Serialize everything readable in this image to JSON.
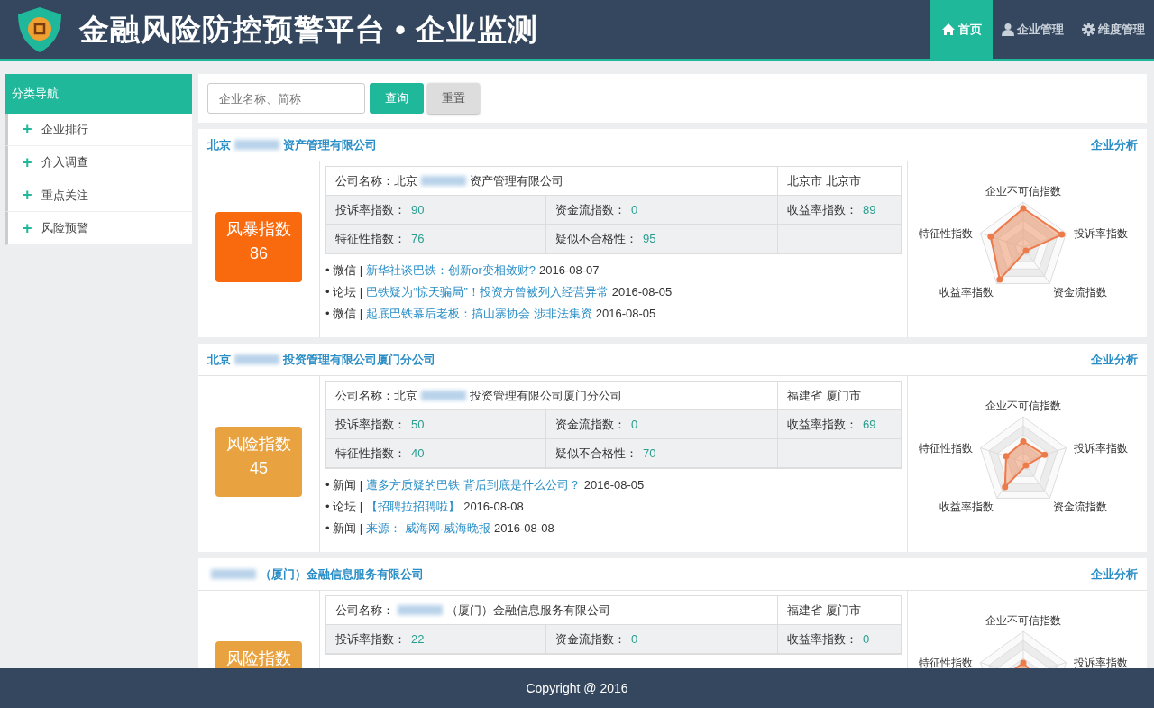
{
  "header": {
    "title": "金融风险防控预警平台 • 企业监测",
    "nav": [
      {
        "label": "首页",
        "selected": true
      },
      {
        "label": "企业管理",
        "selected": false
      },
      {
        "label": "维度管理",
        "selected": false
      }
    ]
  },
  "sidebar": {
    "title": "分类导航",
    "items": [
      {
        "label": "企业排行",
        "icon": "+"
      },
      {
        "label": "介入调查",
        "icon": "+"
      },
      {
        "label": "重点关注",
        "icon": "+"
      },
      {
        "label": "风险预警",
        "icon": "+"
      }
    ]
  },
  "search": {
    "placeholder": "企业名称、简称",
    "buttons": [
      {
        "label": "查询",
        "kind": "primary"
      },
      {
        "label": "重置",
        "kind": "secondary"
      }
    ]
  },
  "companies": [
    {
      "heading": {
        "before": "北京",
        "after": "资产管理有限公司",
        "blurred": true
      },
      "link": "企业分析",
      "badge": {
        "label": "风暴指数",
        "score": "86",
        "color": "#f96a0f"
      },
      "info_label": "公司名称：",
      "info_name": {
        "before": "北京",
        "after": "资产管理有限公司",
        "blurred": true
      },
      "location": "北京市 北京市",
      "metrics": [
        {
          "label": "投诉率指数：",
          "value": "90"
        },
        {
          "label": "资金流指数：",
          "value": "0"
        },
        {
          "label": "收益率指数：",
          "value": "89"
        },
        {
          "label": "特征性指数：",
          "value": "76"
        },
        {
          "label": "疑似不合格性：",
          "value": "95"
        }
      ],
      "news": [
        {
          "source": "• 微信 |",
          "title": "新华社谈巴铁：创新or变相敛财?",
          "date": "2016-08-07"
        },
        {
          "source": "• 论坛 |",
          "title": "巴铁疑为“惊天骗局”！投资方曾被列入经营异常",
          "date": "2016-08-05"
        },
        {
          "source": "• 微信 |",
          "title": "起底巴铁幕后老板：搞山寨协会 涉非法集资",
          "date": "2016-08-05"
        }
      ],
      "radar": [
        {
          "label": "企业不可信指数",
          "kind": "top"
        },
        {
          "label": "投诉率指数",
          "kind": "right"
        },
        {
          "label": "资金流指数",
          "kind": "bottom-right"
        },
        {
          "label": "收益率指数",
          "kind": "bottom-left"
        },
        {
          "label": "特征性指数",
          "kind": "left"
        }
      ]
    },
    {
      "heading": {
        "before": "北京",
        "after": "投资管理有限公司厦门分公司",
        "blurred": true
      },
      "link": "企业分析",
      "badge": {
        "label": "风险指数",
        "score": "45",
        "color": "#e8a23f"
      },
      "info_label": "公司名称：",
      "info_name": {
        "before": "北京",
        "after": "投资管理有限公司厦门分公司",
        "blurred": true
      },
      "location": "福建省 厦门市",
      "metrics": [
        {
          "label": "投诉率指数：",
          "value": "50"
        },
        {
          "label": "资金流指数：",
          "value": "0"
        },
        {
          "label": "收益率指数：",
          "value": "69"
        },
        {
          "label": "特征性指数：",
          "value": "40"
        },
        {
          "label": "疑似不合格性：",
          "value": "70"
        }
      ],
      "news": [
        {
          "source": "• 新闻 |",
          "title": "遭多方质疑的巴铁 背后到底是什么公司？",
          "date": "2016-08-05"
        },
        {
          "source": "• 论坛 |",
          "title": "【招聘拉招聘啦】",
          "date": "2016-08-08"
        },
        {
          "source": "• 新闻 |",
          "title": "来源： 威海网·威海晚报",
          "date": "2016-08-08"
        }
      ],
      "radar": [
        {
          "label": "企业不可信指数",
          "kind": "top"
        },
        {
          "label": "投诉率指数",
          "kind": "right"
        },
        {
          "label": "资金流指数",
          "kind": "bottom-right"
        },
        {
          "label": "收益率指数",
          "kind": "bottom-left"
        },
        {
          "label": "特征性指数",
          "kind": "left"
        }
      ]
    },
    {
      "heading": {
        "after": "（厦门）金融信息服务有限公司",
        "blurred": true
      },
      "link": "企业分析",
      "badge": {
        "label": "风险指数",
        "color": "#e8a23f"
      },
      "info_label": "公司名称：",
      "info_name": {
        "after": "（厦门）金融信息服务有限公司",
        "blurred": true
      },
      "location": "福建省 厦门市",
      "metrics": [
        {
          "label": "投诉率指数：",
          "value": "22"
        },
        {
          "label": "资金流指数：",
          "value": "0"
        },
        {
          "label": "收益率指数：",
          "value": "0"
        }
      ],
      "radar": [
        {
          "label": "企业不可信指数",
          "kind": "top"
        },
        {
          "label": "投诉率指数",
          "kind": "right"
        },
        {
          "label": "特征性指数",
          "kind": "left"
        }
      ]
    }
  ],
  "footer": {
    "text": "Copyright @ 2016"
  }
}
